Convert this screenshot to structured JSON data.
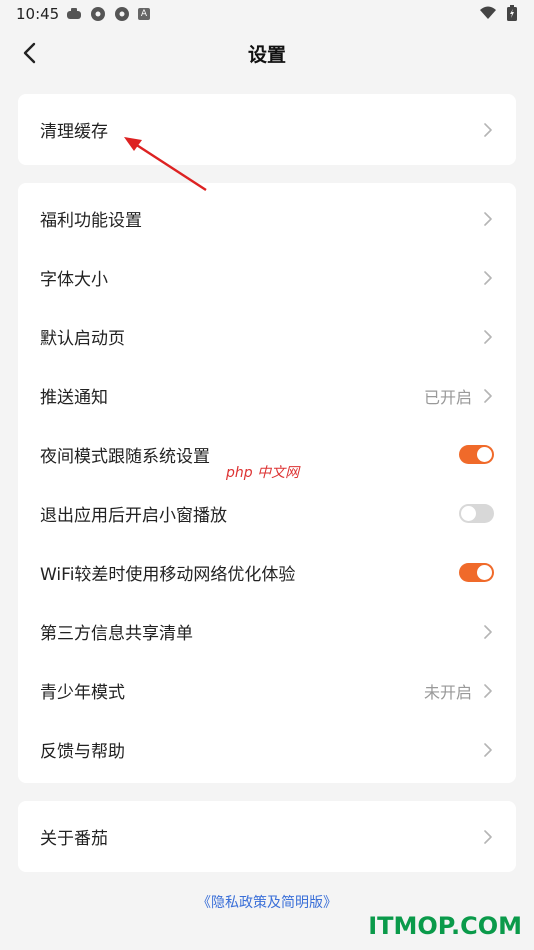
{
  "status_bar": {
    "time": "10:45",
    "notif_badge": "A"
  },
  "header": {
    "title": "设置"
  },
  "group1": [
    {
      "label": "清理缓存",
      "value": "",
      "control": "chevron"
    }
  ],
  "group2": [
    {
      "label": "福利功能设置",
      "value": "",
      "control": "chevron"
    },
    {
      "label": "字体大小",
      "value": "",
      "control": "chevron"
    },
    {
      "label": "默认启动页",
      "value": "",
      "control": "chevron"
    },
    {
      "label": "推送通知",
      "value": "已开启",
      "control": "chevron"
    },
    {
      "label": "夜间模式跟随系统设置",
      "value": "",
      "control": "toggle",
      "on": true
    },
    {
      "label": "退出应用后开启小窗播放",
      "value": "",
      "control": "toggle",
      "on": false
    },
    {
      "label": "WiFi较差时使用移动网络优化体验",
      "value": "",
      "control": "toggle",
      "on": true
    },
    {
      "label": "第三方信息共享清单",
      "value": "",
      "control": "chevron"
    },
    {
      "label": "青少年模式",
      "value": "未开启",
      "control": "chevron"
    },
    {
      "label": "反馈与帮助",
      "value": "",
      "control": "chevron"
    }
  ],
  "group3": [
    {
      "label": "关于番茄",
      "value": "",
      "control": "chevron"
    }
  ],
  "footer": {
    "policy_link": "《隐私政策及简明版》"
  },
  "watermarks": {
    "php": "php 中文网",
    "site": "ITMOP.COM"
  },
  "colors": {
    "accent": "#f06a2a",
    "link": "#3a6fd8",
    "toggle_off": "#d8d8d8",
    "background": "#f4f4f4"
  }
}
